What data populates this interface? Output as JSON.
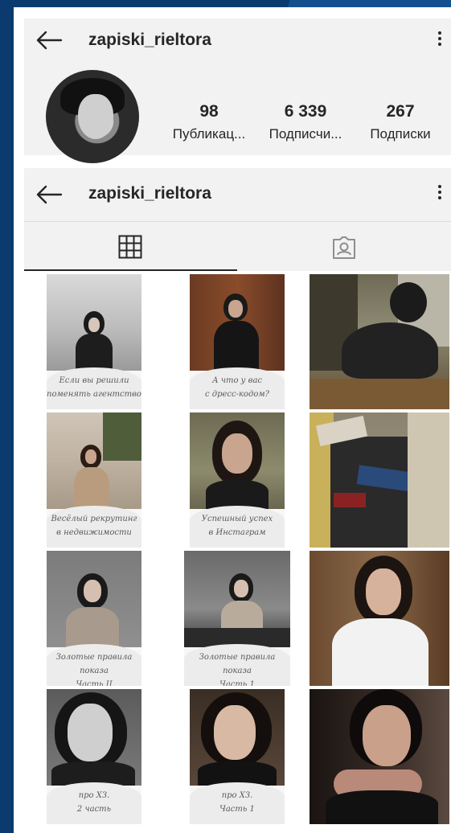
{
  "profile": {
    "username": "zapiski_rieltora",
    "stats": [
      {
        "value": "98",
        "label": "Публикац..."
      },
      {
        "value": "6 339",
        "label": "Подписчи..."
      },
      {
        "value": "267",
        "label": "Подписки"
      }
    ]
  },
  "header2": {
    "username": "zapiski_rieltora"
  },
  "tabs": [
    {
      "icon": "grid-icon",
      "active": true
    },
    {
      "icon": "tagged-icon",
      "active": false
    }
  ],
  "posts": [
    {
      "caption_line1": "Если вы решили",
      "caption_line2": "поменять агентство"
    },
    {
      "caption_line1": "А что у вас",
      "caption_line2": "с дресс-кодом?"
    },
    {
      "caption_line1": "",
      "caption_line2": ""
    },
    {
      "caption_line1": "Весёлый рекрутинг",
      "caption_line2": "в недвижимости"
    },
    {
      "caption_line1": "Успешный успех",
      "caption_line2": "в Инстаграм"
    },
    {
      "caption_line1": "",
      "caption_line2": ""
    },
    {
      "caption_line1": "Золотые правила показа",
      "caption_line2": "Часть II"
    },
    {
      "caption_line1": "Золотые правила показа",
      "caption_line2": "Часть 1"
    },
    {
      "caption_line1": "",
      "caption_line2": ""
    },
    {
      "caption_line1": "про ХЗ.",
      "caption_line2": "2 часть"
    },
    {
      "caption_line1": "про ХЗ.",
      "caption_line2": "Часть 1"
    },
    {
      "caption_line1": "",
      "caption_line2": ""
    }
  ],
  "colors": {
    "background": "#0b3a6e",
    "text": "#262626",
    "header_bg": "#f2f2f2"
  }
}
